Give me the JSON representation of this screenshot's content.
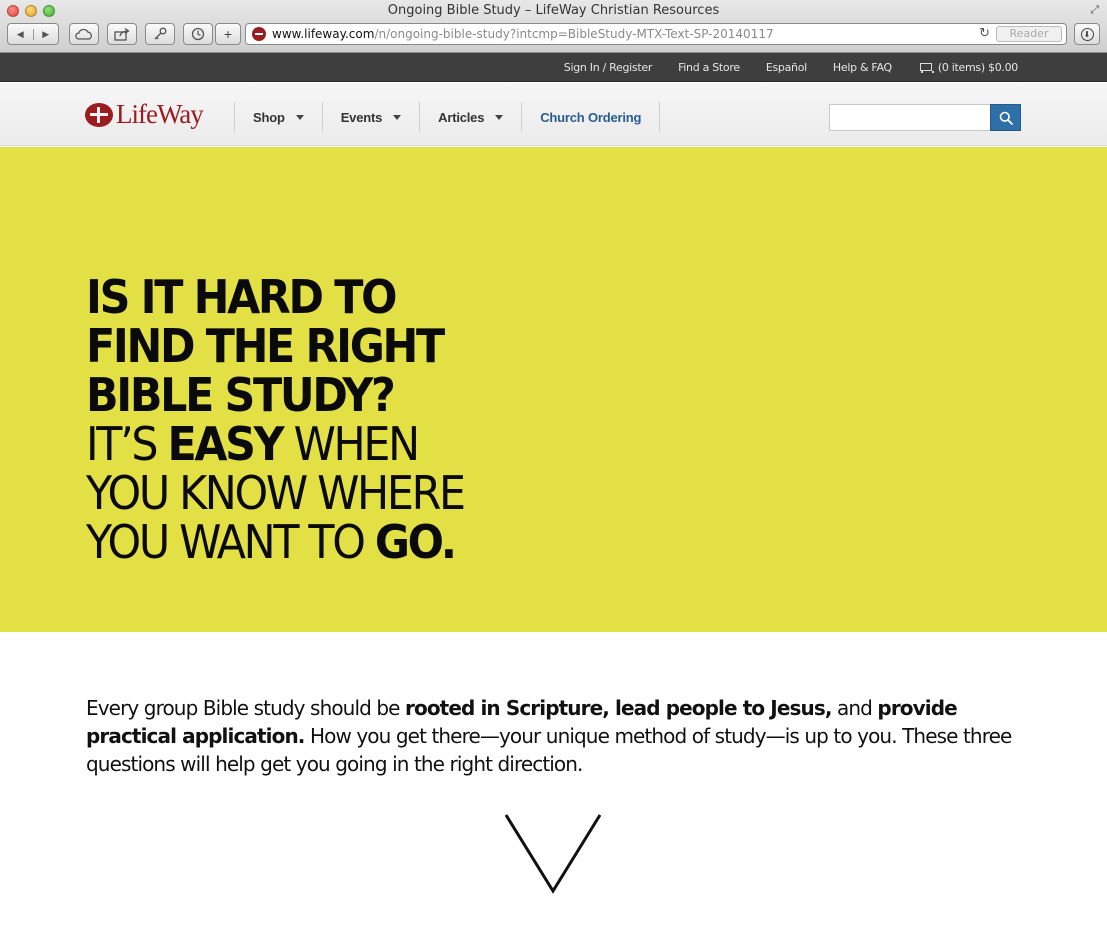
{
  "browser": {
    "window_title": "Ongoing Bible Study – LifeWay Christian Resources",
    "url_host": "www.lifeway.com",
    "url_path": "/n/ongoing-bible-study?intcmp=BibleStudy-MTX-Text-SP-20140117",
    "reader_label": "Reader",
    "icons": [
      "back-icon",
      "forward-icon",
      "icloud-tabs-icon",
      "share-icon",
      "passwords-icon",
      "history-icon",
      "new-tab-icon",
      "reload-icon",
      "downloads-icon"
    ]
  },
  "utility_bar": {
    "sign_in": "Sign In / Register",
    "find_store": "Find a Store",
    "espanol": "Español",
    "help": "Help & FAQ",
    "cart": "(0 items) $0.00"
  },
  "header": {
    "logo_text": "LifeWay",
    "nav": {
      "shop": "Shop",
      "events": "Events",
      "articles": "Articles",
      "church_ordering": "Church Ordering"
    },
    "search_placeholder": ""
  },
  "hero": {
    "line1": "IS IT HARD TO",
    "line2": "FIND THE RIGHT",
    "line3": "BIBLE STUDY?",
    "line4_pre": "IT’S ",
    "line4_bold": "EASY",
    "line4_post": " WHEN",
    "line5": "YOU KNOW WHERE",
    "line6_pre": "YOU WANT TO ",
    "line6_bold": "GO."
  },
  "intro": {
    "p1": "Every group Bible study should be ",
    "b1": "rooted in Scripture, lead people to Jesus,",
    "p2": " and ",
    "b2": "provide practical application.",
    "p3": " How you get there—your unique method of study—is up to you. These three questions will help get you going in the right direction."
  },
  "colors": {
    "hero_bg": "#e3e045",
    "brand_red": "#9b1b1f",
    "church_ordering_link": "#2a5d8f",
    "search_button": "#2f6fa8",
    "utility_bar_bg": "#3e3e3e"
  }
}
